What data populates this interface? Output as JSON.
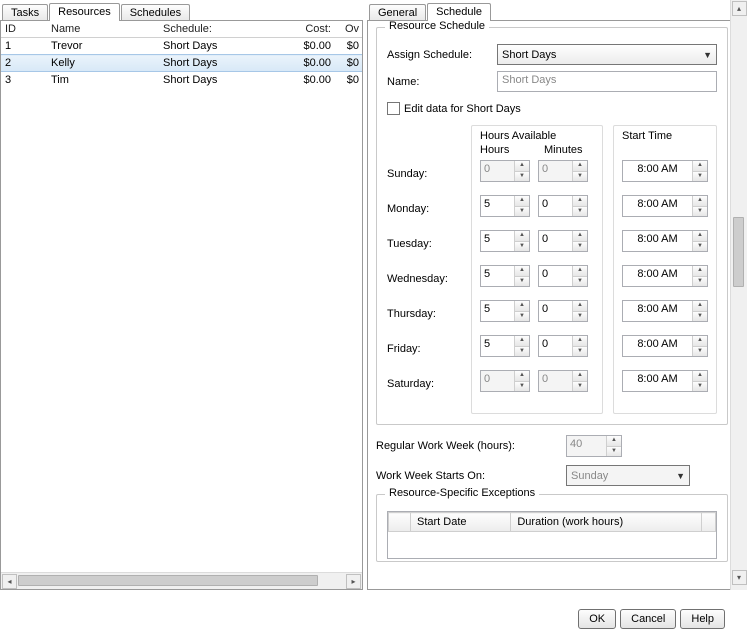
{
  "left_tabs": {
    "tasks": "Tasks",
    "resources": "Resources",
    "schedules": "Schedules"
  },
  "right_tabs": {
    "general": "General",
    "schedule": "Schedule"
  },
  "columns": {
    "id": "ID",
    "name": "Name",
    "schedule": "Schedule:",
    "cost": "Cost:",
    "ov": "Ov"
  },
  "rows": [
    {
      "id": "1",
      "name": "Trevor",
      "schedule": "Short Days",
      "cost": "$0.00",
      "ov": "$0"
    },
    {
      "id": "2",
      "name": "Kelly",
      "schedule": "Short Days",
      "cost": "$0.00",
      "ov": "$0"
    },
    {
      "id": "3",
      "name": "Tim",
      "schedule": "Short Days",
      "cost": "$0.00",
      "ov": "$0"
    }
  ],
  "panel": {
    "legend": "Resource Schedule",
    "assign_label": "Assign Schedule:",
    "assign_value": "Short Days",
    "name_label": "Name:",
    "name_value": "Short Days",
    "edit_checkbox": "Edit data for Short Days",
    "hours_available": "Hours Available",
    "hours": "Hours",
    "minutes": "Minutes",
    "start_time": "Start Time",
    "days": {
      "sunday": {
        "label": "Sunday:",
        "h": "0",
        "m": "0",
        "start": "8:00 AM",
        "enabled": false
      },
      "monday": {
        "label": "Monday:",
        "h": "5",
        "m": "0",
        "start": "8:00 AM",
        "enabled": true
      },
      "tuesday": {
        "label": "Tuesday:",
        "h": "5",
        "m": "0",
        "start": "8:00 AM",
        "enabled": true
      },
      "wednesday": {
        "label": "Wednesday:",
        "h": "5",
        "m": "0",
        "start": "8:00 AM",
        "enabled": true
      },
      "thursday": {
        "label": "Thursday:",
        "h": "5",
        "m": "0",
        "start": "8:00 AM",
        "enabled": true
      },
      "friday": {
        "label": "Friday:",
        "h": "5",
        "m": "0",
        "start": "8:00 AM",
        "enabled": true
      },
      "saturday": {
        "label": "Saturday:",
        "h": "0",
        "m": "0",
        "start": "8:00 AM",
        "enabled": false
      }
    },
    "regular_label": "Regular Work Week (hours):",
    "regular_value": "40",
    "week_starts_label": "Work Week Starts On:",
    "week_starts_value": "Sunday",
    "exceptions_legend": "Resource-Specific Exceptions",
    "exc_cols": {
      "start": "Start Date",
      "duration": "Duration (work hours)"
    }
  },
  "buttons": {
    "ok": "OK",
    "cancel": "Cancel",
    "help": "Help"
  }
}
